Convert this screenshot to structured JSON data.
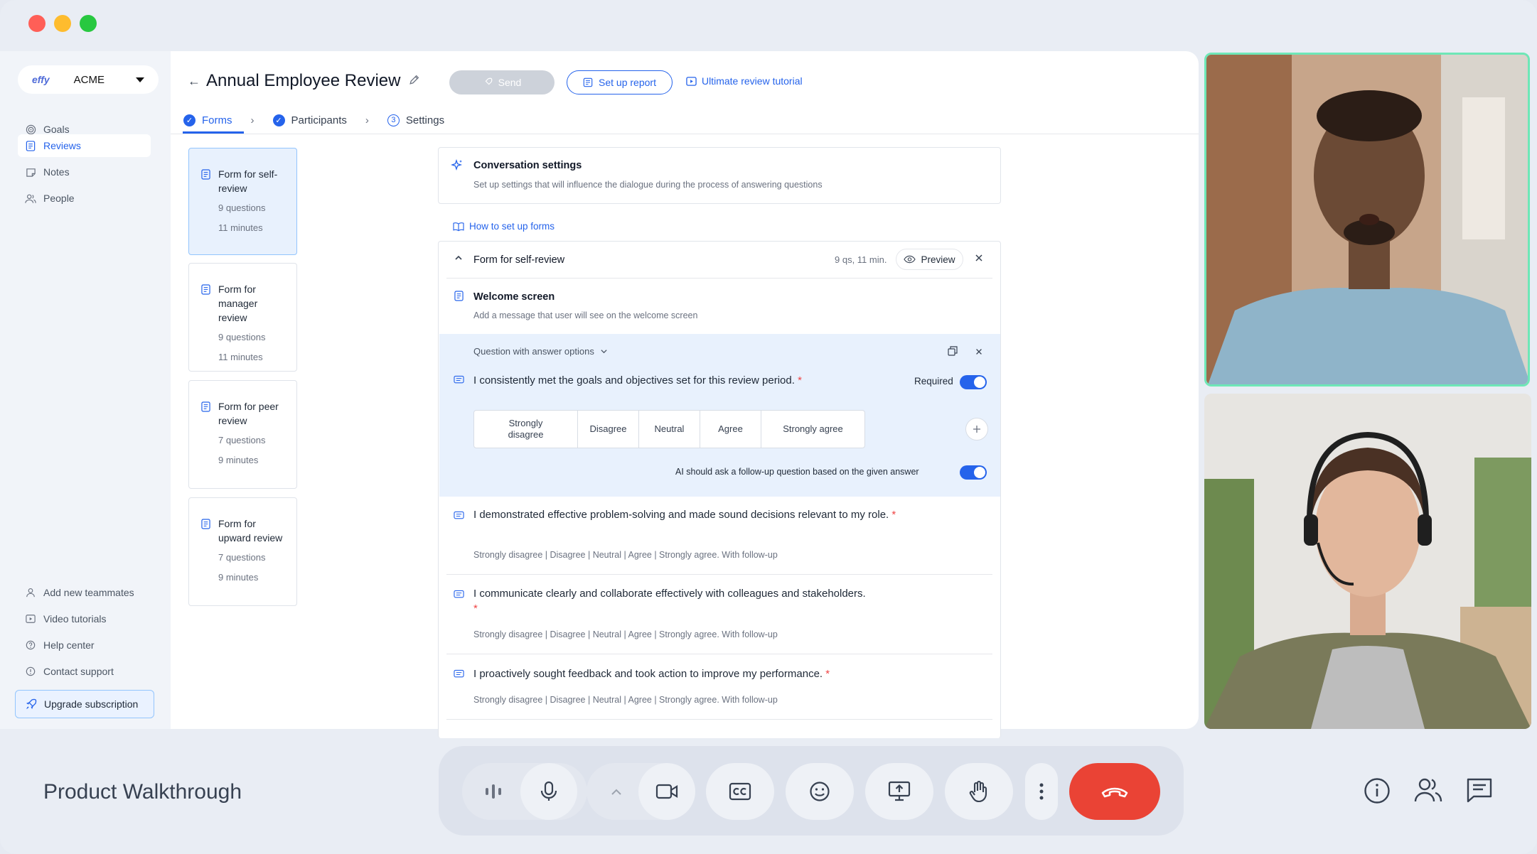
{
  "sidebar": {
    "workspace_logo": "effy",
    "workspace_name": "ACME",
    "nav": [
      "Goals",
      "Reviews",
      "Notes",
      "People"
    ],
    "footer": [
      "Add new teammates",
      "Video tutorials",
      "Help center",
      "Contact support"
    ],
    "upgrade": "Upgrade subscription"
  },
  "header": {
    "title": "Annual Employee Review",
    "send": "Send",
    "report": "Set up report",
    "tutorial": "Ultimate review tutorial"
  },
  "tabs": [
    {
      "label": "Forms"
    },
    {
      "label": "Participants"
    },
    {
      "label": "Settings",
      "num": "3"
    }
  ],
  "form_cards": [
    {
      "title": "Form for self-review",
      "questions": "9 questions",
      "minutes": "11 minutes"
    },
    {
      "title": "Form for manager review",
      "questions": "9 questions",
      "minutes": "11 minutes"
    },
    {
      "title": "Form for peer review",
      "questions": "7 questions",
      "minutes": "9 minutes"
    },
    {
      "title": "Form for upward review",
      "questions": "7 questions",
      "minutes": "9 minutes"
    }
  ],
  "conversation": {
    "title": "Conversation settings",
    "desc": "Set up settings that will influence the dialogue during the process of answering questions"
  },
  "how_to": "How to set up forms",
  "form": {
    "title": "Form for self-review",
    "meta": "9 qs, 11 min.",
    "preview": "Preview",
    "welcome_title": "Welcome screen",
    "welcome_desc": "Add a message that user will see on the welcome screen",
    "question_type": "Question with answer options",
    "q1": "I consistently met the goals and objectives set for this review period.",
    "required": "Required",
    "options": [
      "Strongly disagree",
      "Disagree",
      "Neutral",
      "Agree",
      "Strongly agree"
    ],
    "followup": "AI should ask a follow-up question based on the given answer",
    "questions": [
      {
        "text": "I demonstrated effective problem-solving and made sound decisions relevant to my role.",
        "opts": "Strongly disagree | Disagree | Neutral | Agree | Strongly agree. With follow-up"
      },
      {
        "text": "I communicate clearly and collaborate effectively with colleagues and stakeholders.",
        "opts": "Strongly disagree | Disagree | Neutral | Agree | Strongly agree. With follow-up"
      },
      {
        "text": "I proactively sought feedback and took action to improve my performance.",
        "opts": "Strongly disagree | Disagree | Neutral | Agree | Strongly agree. With follow-up"
      }
    ],
    "star": "*"
  },
  "call": {
    "name": "Product Walkthrough"
  },
  "colors": {
    "accent": "#2563eb",
    "end_call": "#ea4335",
    "active_speaker": "#6ee7b7"
  }
}
